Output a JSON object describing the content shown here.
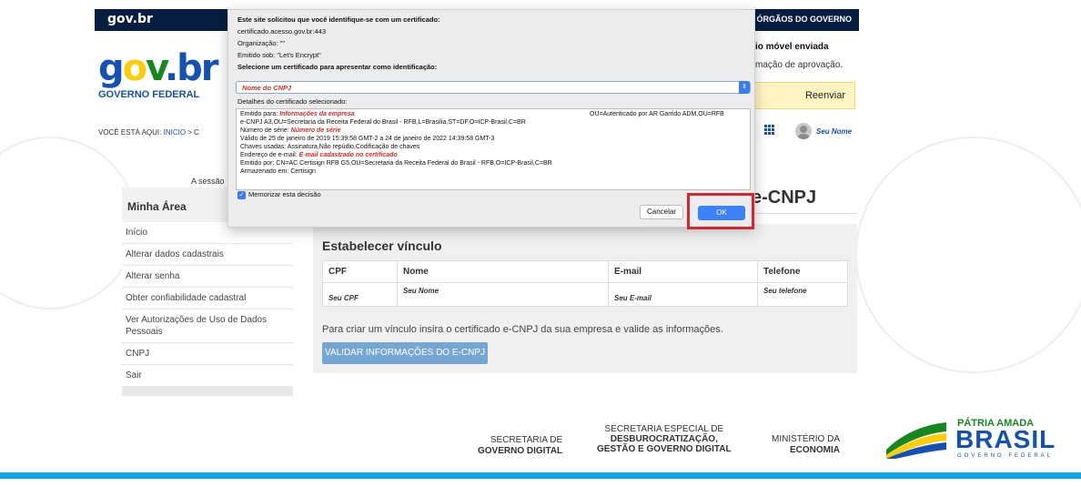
{
  "header": {
    "govbr": "gov.br",
    "orgaos": "ÓRGÃOS DO GOVERNO"
  },
  "logo": {
    "word": "gov.br",
    "sub": "GOVERNO FEDERAL"
  },
  "notice": {
    "line1": "io móvel enviada",
    "line2": "mação de aprovação.",
    "resend": "Reenviar"
  },
  "breadcrumb": {
    "prefix": "VOCÊ ESTÁ AQUI:",
    "inicio": "INICIO",
    "sep": "> C"
  },
  "user": {
    "name": "Seu Nome"
  },
  "session_text": "A sessão",
  "sidebar": {
    "title": "Minha Área",
    "items": [
      {
        "label": "Início"
      },
      {
        "label": "Alterar dados cadastrais"
      },
      {
        "label": "Alterar senha"
      },
      {
        "label": "Obter confiabilidade cadastral"
      },
      {
        "label": "Ver Autorizações de Uso de Dados Pessoais"
      },
      {
        "label": "CNPJ"
      },
      {
        "label": "Sair"
      }
    ]
  },
  "main": {
    "heading": "e-CNPJ",
    "section_title": "Estabelecer vínculo",
    "table": {
      "headers": [
        "CPF",
        "Nome",
        "E-mail",
        "Telefone"
      ],
      "row": [
        "Seu CPF",
        "Seu Nome",
        "Seu E-mail",
        "Seu telefone"
      ]
    },
    "description": "Para criar um vínculo insira o certificado e-CNPJ da sua empresa e valide as informações.",
    "validate_button": "VALIDAR INFORMAÇÕES DO E-CNPJ"
  },
  "dialog": {
    "line1": "Este site solicitou que você identifique-se com um certificado:",
    "line2": "certificado.acesso.gov.br:443",
    "line3": "Organização: \"\"",
    "line4": "Emitido sob: \"Let's Encrypt\"",
    "line5": "Selecione um certificado para apresentar como identificação:",
    "select_value": "Nome do CNPJ",
    "details_label": "Detalhes do certificado selecionado:",
    "details": {
      "issued_to_label": "Emitido para: ",
      "issued_to_value": "Informações da empresa",
      "issued_to_right": "OU=Autenticado por AR Garrido ADM,OU=RFB",
      "ecnpj": "e-CNPJ A3,OU=Secretaria da Receita Federal do Brasil - RFB,L=Brasilia,ST=DF,O=ICP-Brasil,C=BR",
      "serial_label": "Número de série: ",
      "serial_value": "Número de série",
      "validity": "Válido de 25 de janeiro de 2019 15:39:58 GMT-2 a 24 de janeiro de 2022 14:39:58 GMT-3",
      "keys": "Chaves usadas: Assinatura,Não repúdio,Codificação de chaves",
      "email_label": "Endereço de e-mail: ",
      "email_value": "E-mail cadastrado no certificado",
      "issuer": "Emitido por: CN=AC Certisign RFB G5,OU=Secretaria da Receita Federal do Brasil - RFB,O=ICP-Brasil,C=BR",
      "stored": "Armazenado em: Certisign"
    },
    "remember": "Memorizar esta decisão",
    "cancel": "Cancelar",
    "ok": "OK"
  },
  "footer": {
    "sec1_top": "SECRETARIA DE",
    "sec1_bottom": "GOVERNO DIGITAL",
    "sec2_top": "SECRETARIA ESPECIAL DE",
    "sec2_mid": "DESBUROCRATIZAÇÃO,",
    "sec2_bottom": "GESTÃO E GOVERNO DIGITAL",
    "min_top": "MINISTÉRIO DA",
    "min_bottom": "ECONOMIA",
    "patria": "PÁTRIA AMADA",
    "brasil": "BRASIL",
    "gov_federal": "GOVERNO FEDERAL"
  },
  "colors": {
    "header_bg": "#071d41",
    "brand_blue": "#1351b4",
    "highlight_red": "#d9232d",
    "ok_blue": "#3b82f6",
    "footer_line": "#0ea5e9"
  }
}
